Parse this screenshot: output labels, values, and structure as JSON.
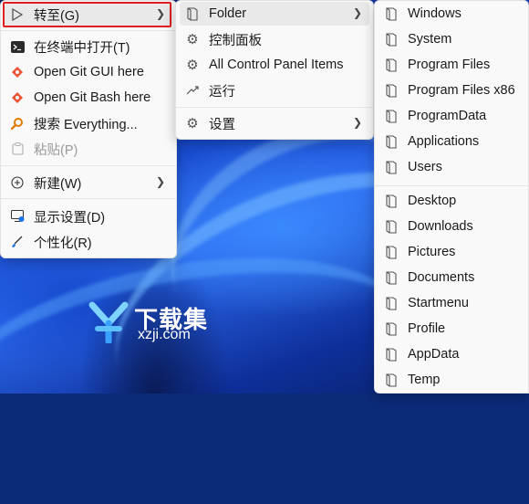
{
  "context_menu": {
    "goto": "转至(G)",
    "terminal": "在终端中打开(T)",
    "git_gui": "Open Git GUI here",
    "git_bash": "Open Git Bash here",
    "search_everything": "搜索 Everything...",
    "paste": "粘贴(P)",
    "new": "新建(W)",
    "display_settings": "显示设置(D)",
    "personalize": "个性化(R)"
  },
  "goto_menu": {
    "folder": "Folder",
    "control_panel": "控制面板",
    "all_control_panel": "All Control Panel Items",
    "run": "运行",
    "settings": "设置"
  },
  "folder_menu": {
    "group1": [
      "Windows",
      "System",
      "Program Files",
      "Program Files x86",
      "ProgramData",
      "Applications",
      "Users"
    ],
    "group2": [
      "Desktop",
      "Downloads",
      "Pictures",
      "Documents",
      "Startmenu",
      "Profile",
      "AppData",
      "Temp"
    ]
  },
  "watermark": {
    "cn": "下载集",
    "url": "xzji.com"
  },
  "colors": {
    "menu_bg": "#f9f9f9",
    "selection_border": "#e02020"
  }
}
